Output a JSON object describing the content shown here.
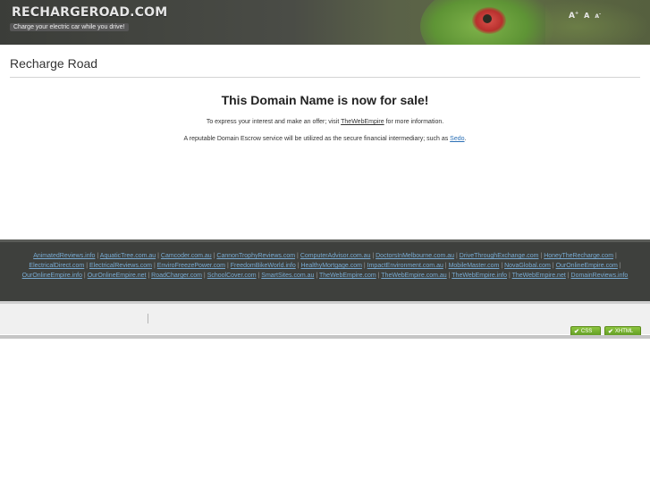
{
  "header": {
    "site_title": "RECHARGEROAD.COM",
    "tagline": "Charge your electric car while you drive!",
    "font_controls": {
      "increase": "A",
      "reset": "A",
      "decrease": "A"
    }
  },
  "main": {
    "page_heading": "Recharge Road",
    "sale_title": "This Domain Name is now for sale!",
    "line1_before": "To express your interest and make an offer; visit ",
    "line1_link": "TheWebEmpire",
    "line1_after": " for more information.",
    "line2_before": "A reputable Domain Escrow service will be utilized as the secure financial intermediary; such as ",
    "line2_link": "Sedo",
    "line2_after": "."
  },
  "links": [
    "AnimatedReviews.info",
    "AquaticTree.com.au",
    "Camcoder.com.au",
    "CannonTrophyReviews.com",
    "ComputerAdvisor.com.au",
    "DoctorsInMelbourne.com.au",
    "DriveThroughExchange.com",
    "HoneyTheRecharge.com",
    "ElectricalDirect.com",
    "ElectricalReviews.com",
    "EnviroFreezePower.com",
    "FreedomBikeWorld.info",
    "HealthyMortgage.com",
    "ImpactEnvironment.com.au",
    "MobileMaster.com",
    "NovaGlobal.com",
    "OurOnlineEmpire.com",
    "OurOnlineEmpire.info",
    "OurOnlineEmpire.net",
    "RoadCharger.com",
    "SchoolCover.com",
    "SmartSites.com.au",
    "TheWebEmpire.com",
    "TheWebEmpire.com.au",
    "TheWebEmpire.info",
    "TheWebEmpire.net",
    "DomainReviews.info"
  ],
  "footer": {
    "badge_css": "CSS",
    "badge_xhtml": "XHTML"
  },
  "colors": {
    "link_blue": "#2a6fb5",
    "band_link": "#78aad2",
    "band_bg": "#3e403d",
    "badge_green": "#8dc63f"
  }
}
